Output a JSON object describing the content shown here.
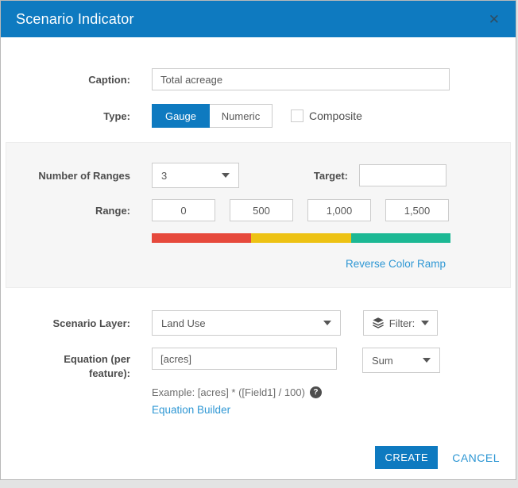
{
  "window": {
    "title": "Scenario Indicator"
  },
  "icons": {
    "close": "✕",
    "help": "?"
  },
  "form": {
    "caption": {
      "label": "Caption:",
      "value": "Total acreage"
    },
    "type": {
      "label": "Type:",
      "options": [
        {
          "label": "Gauge",
          "selected": true
        },
        {
          "label": "Numeric",
          "selected": false
        }
      ],
      "composite": {
        "label": "Composite",
        "checked": false
      }
    },
    "ranges": {
      "number_label": "Number of Ranges",
      "number_value": "3",
      "target_label": "Target:",
      "target_value": "",
      "range_label": "Range:",
      "values": [
        "0",
        "500",
        "1,000",
        "1,500"
      ],
      "reverse_link": "Reverse Color Ramp"
    },
    "scenario_layer": {
      "label": "Scenario Layer:",
      "value": "Land Use",
      "filter_label": "Filter:"
    },
    "equation": {
      "label": "Equation (per feature):",
      "value": "[acres]",
      "aggregation_value": "Sum",
      "example": "Example: [acres] * ([Field1] / 100)",
      "builder_link": "Equation Builder"
    }
  },
  "footer": {
    "create": "CREATE",
    "cancel": "CANCEL"
  },
  "colors": {
    "header": "#0e7ac0",
    "accent": "#0e7ac0",
    "link": "#2e97d4",
    "ramp": [
      "#e6493c",
      "#edc214",
      "#1cb894"
    ]
  }
}
